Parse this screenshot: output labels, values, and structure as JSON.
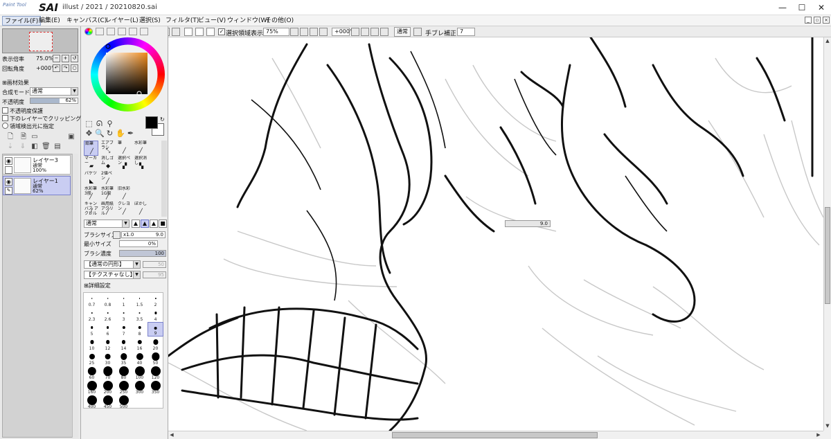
{
  "app": {
    "logo_small": "Paint Tool",
    "logo_big": "SAI",
    "title": "illust / 2021 / 20210820.sai"
  },
  "menu": [
    "ファイル(F)",
    "編集(E)",
    "キャンバス(C)",
    "レイヤー(L)",
    "選択(S)",
    "フィルタ(T)",
    "ビュー(V)",
    "ウィンドウ(W)",
    "その他(O)"
  ],
  "toolbar": {
    "selection_visible_label": "選択領域表示",
    "zoom": "75%",
    "rotation": "+000°",
    "blend": "通常",
    "stabilizer_label": "手ブレ補正",
    "stabilizer_value": "7"
  },
  "navigator": {
    "zoom_label": "表示倍率",
    "zoom_value": "75.0%",
    "angle_label": "回転角度",
    "angle_value": "+000°"
  },
  "layer_panel": {
    "effects_label": "画材効果",
    "blend_label": "合成モード",
    "blend_value": "通常",
    "opacity_label": "不透明度",
    "opacity_value": "62%",
    "opacity_fraction": 0.62,
    "preserve_opacity": "不透明度保護",
    "clip_lower": "下のレイヤーでクリッピング",
    "selection_source": "領域検出元に指定",
    "layers": [
      {
        "name": "レイヤー3",
        "mode": "通常",
        "opacity": "100%"
      },
      {
        "name": "レイヤー1",
        "mode": "通常",
        "opacity": "62%"
      }
    ]
  },
  "brushes": [
    "鉛筆",
    "エアブラシ",
    "筆",
    "水彩筆",
    "マーカー",
    "消しゴム",
    "選択ペン",
    "選択消し",
    "バケツ",
    "2値ペン",
    "",
    "",
    "水彩筆 3般",
    "水彩筆 1G般",
    "旧水彩",
    "",
    "キャンバス アクリル",
    "画用紙 アクリル",
    "クレヨン",
    "ぼかし"
  ],
  "brush_props": {
    "mode": "通常",
    "size_label": "ブラシサイズ",
    "size_multiplier": "x1.0",
    "size_value": "9.0",
    "min_size_label": "最小サイズ",
    "min_size_value": "0%",
    "density_label": "ブラシ濃度",
    "density_value": "100",
    "shape": "【通常の円形】",
    "shape_value": "50",
    "texture": "【テクスチャなし】",
    "texture_value": "95",
    "advanced_label": "詳細設定"
  },
  "brush_sizes": [
    "0.7",
    "0.8",
    "1",
    "1.5",
    "2",
    "2.3",
    "2.6",
    "3",
    "3.5",
    "4",
    "5",
    "6",
    "7",
    "8",
    "9",
    "10",
    "12",
    "14",
    "16",
    "20",
    "25",
    "30",
    "35",
    "40",
    "50",
    "60",
    "70",
    "80",
    "100",
    "120",
    "160",
    "200",
    "250",
    "300",
    "350",
    "400",
    "450",
    "500"
  ],
  "selected_brush_size": "9",
  "canvas_float_value": "9.0",
  "colors": {
    "accent": "#c9cdf2",
    "foreground": "#000000",
    "background": "#ffffff"
  }
}
